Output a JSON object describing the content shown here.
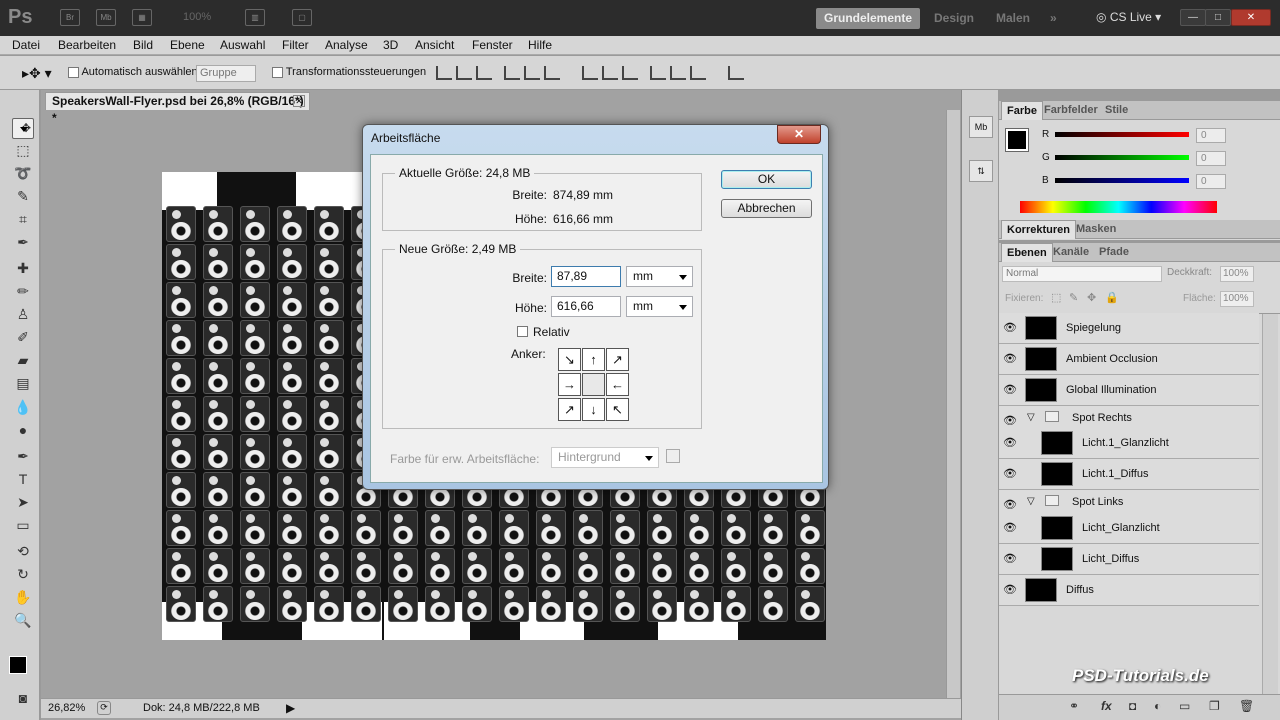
{
  "app": {
    "logo": "Ps",
    "zoom": "100%",
    "workspaces": [
      "Grundelemente",
      "Design",
      "Malen"
    ],
    "cslive": "CS Live"
  },
  "menu": [
    "Datei",
    "Bearbeiten",
    "Bild",
    "Ebene",
    "Auswahl",
    "Filter",
    "Analyse",
    "3D",
    "Ansicht",
    "Fenster",
    "Hilfe"
  ],
  "options": {
    "auto_select": "Automatisch auswählen:",
    "group": "Gruppe",
    "transform": "Transformationssteuerungen"
  },
  "document": {
    "tab_title": "SpeakersWall-Flyer.psd bei 26,8% (RGB/16*) *"
  },
  "status": {
    "zoom": "26,82%",
    "doc": "Dok: 24,8 MB/222,8 MB"
  },
  "dialog": {
    "title": "Arbeitsfläche",
    "current_legend": "Aktuelle Größe: 24,8 MB",
    "width_label": "Breite:",
    "width_value": "874,89 mm",
    "height_label": "Höhe:",
    "height_value": "616,66 mm",
    "new_legend": "Neue Größe: 2,49 MB",
    "new_width": "87,89",
    "new_height": "616,66",
    "unit": "mm",
    "relative": "Relativ",
    "anchor": "Anker:",
    "ext_color_label": "Farbe für erw. Arbeitsfläche:",
    "ext_color": "Hintergrund",
    "ok": "OK",
    "cancel": "Abbrechen"
  },
  "color_panel": {
    "tabs": [
      "Farbe",
      "Farbfelder",
      "Stile"
    ],
    "channels": [
      {
        "name": "R",
        "value": "0",
        "color": "#cc2222"
      },
      {
        "name": "G",
        "value": "0",
        "color": "#22aa22"
      },
      {
        "name": "B",
        "value": "0",
        "color": "#2222cc"
      }
    ]
  },
  "adjust_panel": {
    "tabs": [
      "Korrekturen",
      "Masken"
    ]
  },
  "layers_panel": {
    "tabs": [
      "Ebenen",
      "Kanäle",
      "Pfade"
    ],
    "blend": "Normal",
    "opacity_label": "Deckkraft:",
    "opacity": "100%",
    "fix_label": "Fixieren:",
    "fill_label": "Fläche:",
    "fill": "100%",
    "layers": [
      {
        "name": "Spiegelung",
        "indent": 0,
        "group": false
      },
      {
        "name": "Ambient Occlusion",
        "indent": 0,
        "group": false
      },
      {
        "name": "Global Illumination",
        "indent": 0,
        "group": false
      },
      {
        "name": "Spot Rechts",
        "indent": 0,
        "group": true
      },
      {
        "name": "Licht.1_Glanzlicht",
        "indent": 1,
        "group": false
      },
      {
        "name": "Licht.1_Diffus",
        "indent": 1,
        "group": false
      },
      {
        "name": "Spot Links",
        "indent": 0,
        "group": true
      },
      {
        "name": "Licht_Glanzlicht",
        "indent": 1,
        "group": false
      },
      {
        "name": "Licht_Diffus",
        "indent": 1,
        "group": false
      },
      {
        "name": "Diffus",
        "indent": 0,
        "group": false
      }
    ]
  },
  "watermark": "PSD-Tutorials.de"
}
